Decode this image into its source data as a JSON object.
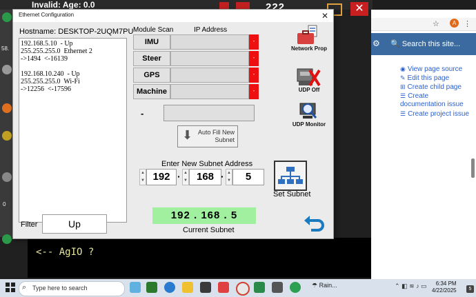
{
  "background_app": {
    "status_text": "Invalid: Age: 0.0",
    "counter": "222",
    "left_value_1": "58.",
    "left_value_2": "0",
    "console_text": "<-- AgIO ?",
    "close_glyph": "✕"
  },
  "browser": {
    "search_placeholder": "Search this site...",
    "avatar_letter": "A",
    "links": [
      {
        "icon": "eye-icon",
        "label": "View page source"
      },
      {
        "icon": "pencil-icon",
        "label": "Edit this page"
      },
      {
        "icon": "add-page-icon",
        "label": "Create child page"
      },
      {
        "icon": "list-icon",
        "label": "Create"
      },
      {
        "icon": "list-icon",
        "label": "documentation issue"
      },
      {
        "icon": "list-icon",
        "label": "Create project issue"
      }
    ]
  },
  "dialog": {
    "title": "Ethernet Configuration",
    "close_glyph": "✕",
    "hostname": "Hostname:  DESKTOP-2UQM7PU",
    "interfaces": [
      "192.168.5.10  - Up",
      "255.255.255.0  Ethernet 2",
      "->1494  <-16139",
      "",
      "192.168.10.240  - Up",
      "255.255.255.0  Wi-Fi",
      "->12256  <-17596"
    ],
    "module_scan_header": "Module Scan",
    "ip_address_header": "IP Address",
    "modules": [
      {
        "label": "IMU",
        "ip": "",
        "status": "-"
      },
      {
        "label": "Steer",
        "ip": "",
        "status": "-"
      },
      {
        "label": "GPS",
        "ip": "",
        "status": "-"
      },
      {
        "label": "Machine",
        "ip": "",
        "status": "-"
      }
    ],
    "status_color": "#ee1010",
    "scan_dash": "-",
    "autofill_label": "Auto Fill New Subnet",
    "enter_subnet_label": "Enter New Subnet Address",
    "octets": [
      "192",
      "168",
      "5"
    ],
    "set_subnet_label": "Set Subnet",
    "current_subnet_value": "192 . 168 . 5",
    "current_subnet_label": "Current Subnet",
    "current_subnet_color": "#a0f0a0",
    "filter_label": "Filter",
    "filter_value": "Up",
    "network_prop_label": "Network Prop",
    "udp_off_label": "UDP Off",
    "udp_monitor_label": "UDP Monitor"
  },
  "taskbar": {
    "search_placeholder": "Type here to search",
    "weather_text": "Rain...",
    "time": "6:34 PM",
    "date": "4/22/2025",
    "notification_count": "5"
  }
}
